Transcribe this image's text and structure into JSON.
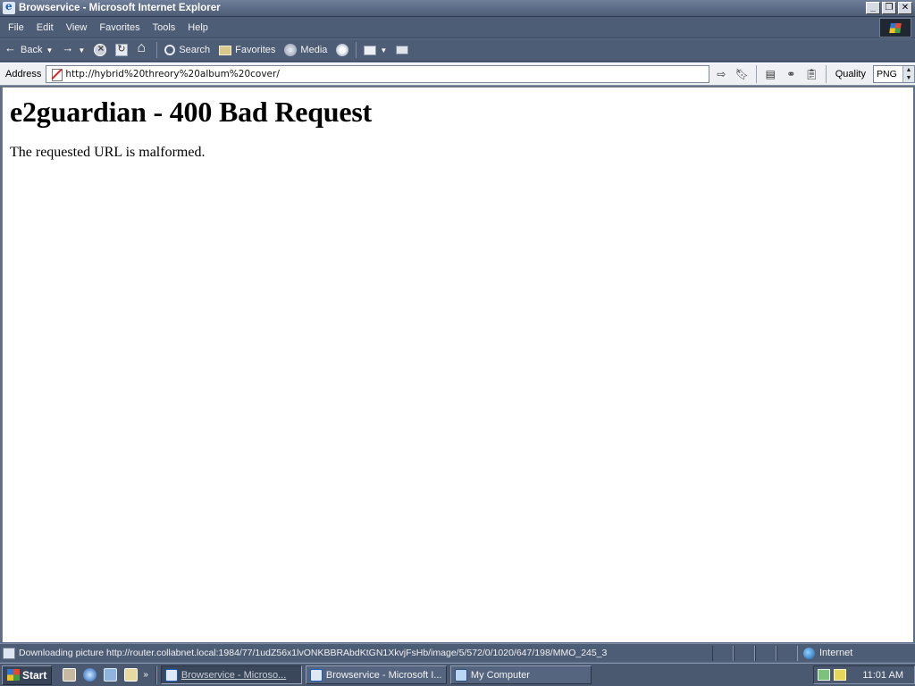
{
  "window": {
    "title": "Browservice - Microsoft Internet Explorer"
  },
  "menu": [
    "File",
    "Edit",
    "View",
    "Favorites",
    "Tools",
    "Help"
  ],
  "toolbar": {
    "back_label": "Back",
    "search_label": "Search",
    "favorites_label": "Favorites",
    "media_label": "Media"
  },
  "address": {
    "label": "Address",
    "url": "http://hybrid%20threory%20album%20cover/"
  },
  "quality": {
    "label": "Quality",
    "value": "PNG"
  },
  "page": {
    "heading": "e2guardian - 400 Bad Request",
    "message": "The requested URL is malformed."
  },
  "status": {
    "text": "Downloading picture http://router.collabnet.local:1984/77/1udZ56x1lvONKBBRAbdKtGN1XkvjFsHb/image/5/572/0/1020/647/198/MMO_245_3",
    "zone": "Internet"
  },
  "taskbar": {
    "start_label": "Start",
    "tasks": [
      "Browservice - Microso...",
      "Browservice - Microsoft I...",
      "My Computer"
    ],
    "clock": "11:01 AM"
  },
  "colors": {
    "chrome": "#4e5d76",
    "titlebar": "#5b6b85",
    "content_bg": "#ffffff"
  }
}
